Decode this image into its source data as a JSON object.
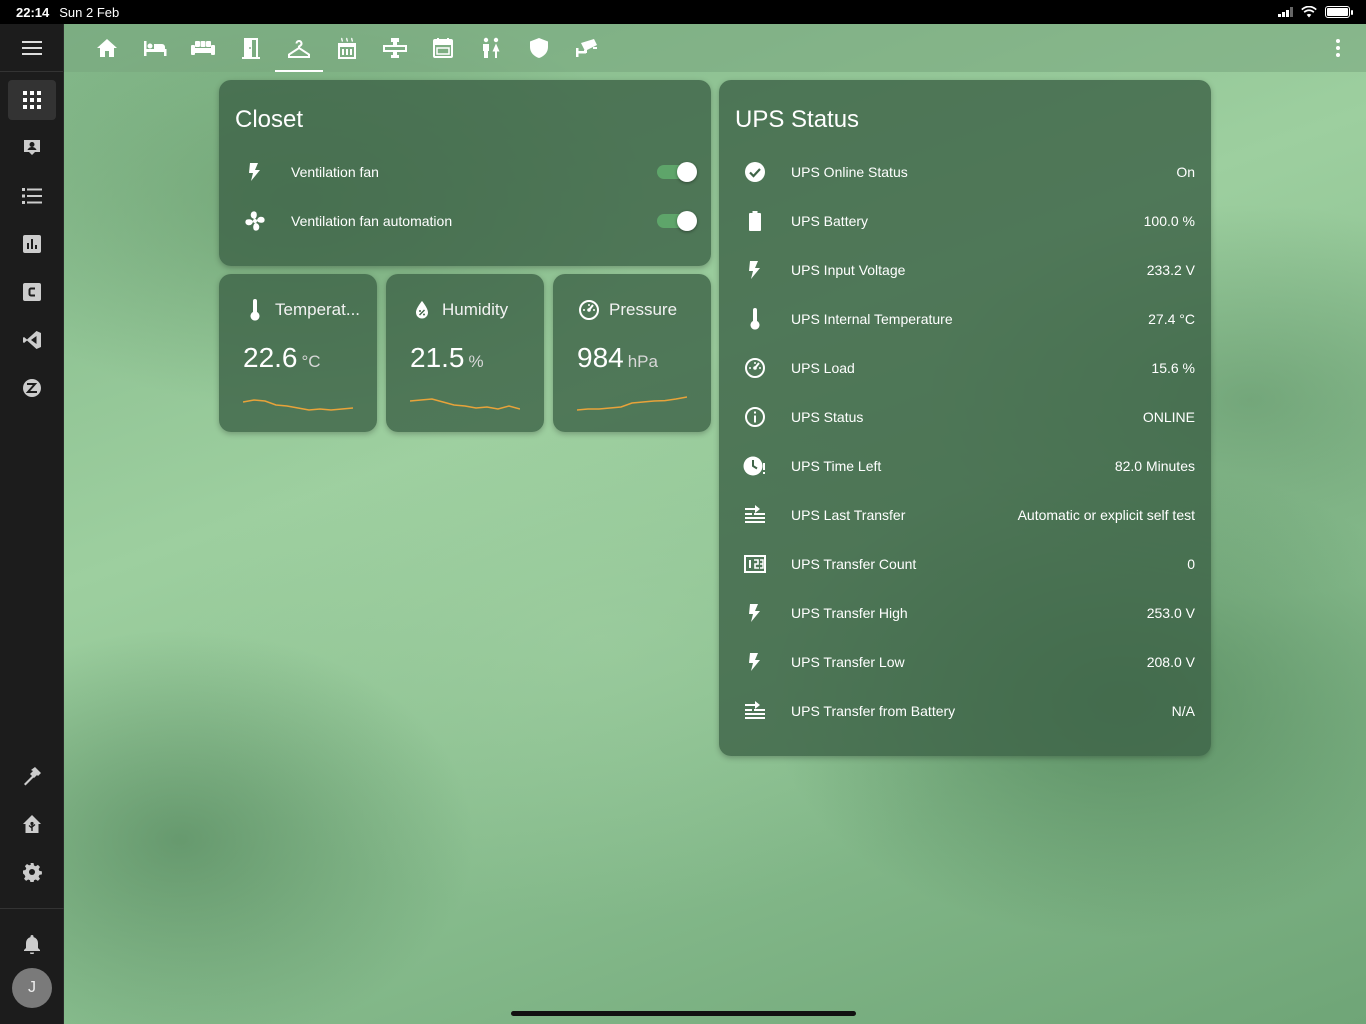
{
  "status_bar": {
    "time": "22:14",
    "date": "Sun 2 Feb"
  },
  "sidebar": {
    "items": [
      {
        "icon": "grid-icon",
        "active": true
      },
      {
        "icon": "account-box-icon"
      },
      {
        "icon": "list-icon"
      },
      {
        "icon": "bar-chart-icon"
      },
      {
        "icon": "c-box-icon"
      },
      {
        "icon": "vscode-icon"
      },
      {
        "icon": "zigbee-icon"
      }
    ],
    "bottom_items": [
      {
        "icon": "hammer-icon"
      },
      {
        "icon": "home-assistant-icon"
      },
      {
        "icon": "gear-icon"
      }
    ],
    "user_initial": "J"
  },
  "toolbar": {
    "tabs": [
      {
        "icon": "home-icon"
      },
      {
        "icon": "bed-icon"
      },
      {
        "icon": "sofa-icon"
      },
      {
        "icon": "door-icon"
      },
      {
        "icon": "hanger-icon",
        "active": true
      },
      {
        "icon": "stove-icon"
      },
      {
        "icon": "pipe-icon"
      },
      {
        "icon": "calendar-icon"
      },
      {
        "icon": "people-icon"
      },
      {
        "icon": "shield-icon"
      },
      {
        "icon": "cctv-icon"
      }
    ]
  },
  "closet": {
    "title": "Closet",
    "rows": [
      {
        "icon": "flash-icon",
        "name": "Ventilation fan",
        "state": "on"
      },
      {
        "icon": "fan-icon",
        "name": "Ventilation fan automation",
        "state": "on"
      }
    ]
  },
  "sensors": [
    {
      "icon": "thermometer-icon",
      "name": "Temperat...",
      "value": "22.6",
      "unit": "°C",
      "trend": [
        0.55,
        0.65,
        0.6,
        0.4,
        0.35,
        0.25,
        0.15,
        0.2,
        0.15,
        0.2,
        0.25
      ]
    },
    {
      "icon": "water-icon",
      "name": "Humidity",
      "value": "21.5",
      "unit": "%",
      "trend": [
        0.6,
        0.65,
        0.7,
        0.55,
        0.4,
        0.35,
        0.25,
        0.3,
        0.2,
        0.35,
        0.2
      ]
    },
    {
      "icon": "gauge-icon",
      "name": "Pressure",
      "value": "984",
      "unit": "hPa",
      "trend": [
        0.15,
        0.2,
        0.2,
        0.25,
        0.3,
        0.5,
        0.55,
        0.6,
        0.62,
        0.7,
        0.8
      ]
    }
  ],
  "ups": {
    "title": "UPS Status",
    "rows": [
      {
        "icon": "check-circle-icon",
        "name": "UPS Online Status",
        "value": "On"
      },
      {
        "icon": "battery-icon",
        "name": "UPS Battery",
        "value": "100.0 %"
      },
      {
        "icon": "flash-icon",
        "name": "UPS Input Voltage",
        "value": "233.2 V"
      },
      {
        "icon": "thermometer-icon",
        "name": "UPS Internal Temperature",
        "value": "27.4 °C"
      },
      {
        "icon": "gauge-icon",
        "name": "UPS Load",
        "value": "15.6 %"
      },
      {
        "icon": "info-icon",
        "name": "UPS Status",
        "value": "ONLINE"
      },
      {
        "icon": "clock-alert-icon",
        "name": "UPS Time Left",
        "value": "82.0 Minutes"
      },
      {
        "icon": "transfer-icon",
        "name": "UPS Last Transfer",
        "value": "Automatic or explicit self test"
      },
      {
        "icon": "counter-icon",
        "name": "UPS Transfer Count",
        "value": "0"
      },
      {
        "icon": "flash-icon",
        "name": "UPS Transfer High",
        "value": "253.0 V"
      },
      {
        "icon": "flash-icon",
        "name": "UPS Transfer Low",
        "value": "208.0 V"
      },
      {
        "icon": "transfer-icon",
        "name": "UPS Transfer from Battery",
        "value": "N/A"
      }
    ]
  },
  "colors": {
    "accent": "#5ea56a",
    "spark": "#e8a33a",
    "sidebar": "#1c1c1c"
  }
}
